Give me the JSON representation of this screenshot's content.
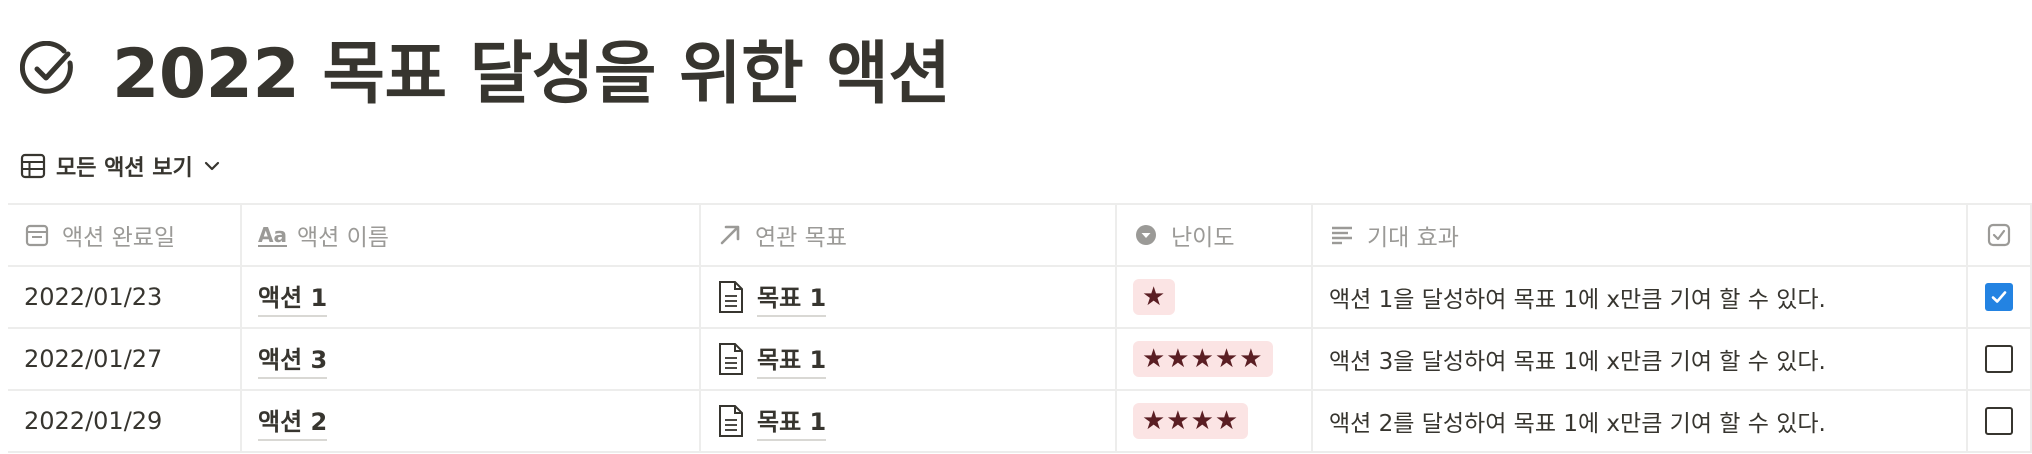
{
  "page": {
    "title": "2022 목표 달성을 위한 액션",
    "view_label": "모든 액션 보기"
  },
  "columns": [
    {
      "label": "액션 완료일",
      "icon": "calendar-icon"
    },
    {
      "label": "액션 이름",
      "icon": "aa-title-icon"
    },
    {
      "label": "연관 목표",
      "icon": "arrow-up-right-icon"
    },
    {
      "label": "난이도",
      "icon": "select-circle-icon"
    },
    {
      "label": "기대 효과",
      "icon": "text-lines-icon"
    },
    {
      "label": "",
      "icon": "checkbox-icon"
    }
  ],
  "rows": [
    {
      "date": "2022/01/23",
      "name": "액션 1",
      "goal": "목표 1",
      "difficulty": 1,
      "difficulty_stars": "★",
      "effect": "액션 1을 달성하여 목표 1에 x만큼 기여 할 수 있다.",
      "done": true
    },
    {
      "date": "2022/01/27",
      "name": "액션 3",
      "goal": "목표 1",
      "difficulty": 5,
      "difficulty_stars": "★★★★★",
      "effect": "액션 3을 달성하여 목표 1에 x만큼 기여 할 수 있다.",
      "done": false
    },
    {
      "date": "2022/01/29",
      "name": "액션 2",
      "goal": "목표 1",
      "difficulty": 4,
      "difficulty_stars": "★★★★",
      "effect": "액션 2를 달성하여 목표 1에 x만큼 기여 할 수 있다.",
      "done": false
    }
  ],
  "colors": {
    "text": "#37352f",
    "muted": "#9b9a97",
    "tag_bg": "#fbe4e4",
    "star": "#5a1e23",
    "checkbox_on": "#2383e2"
  }
}
